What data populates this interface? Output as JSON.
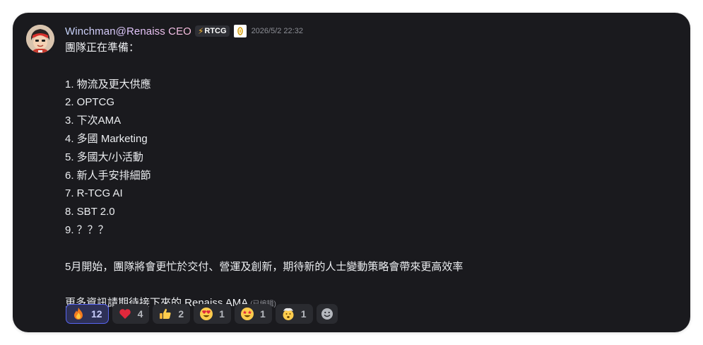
{
  "message": {
    "author": "Winchman@Renaiss CEO",
    "tag_label": "RTCG",
    "timestamp": "2026/5/2 22:32",
    "lines": [
      "團隊正在準備：",
      "",
      "1. 物流及更大供應",
      "2. OPTCG",
      "3. 下次AMA",
      "4. 多國 Marketing",
      "5. 多國大/小活動",
      "6. 新人手安排細節",
      "7. R-TCG AI",
      "8. SBT 2.0",
      "9. ？？？",
      "",
      "5月開始，團隊將會更忙於交付、營運及創新，期待新的人士變動策略會帶來更高效率",
      "",
      "更多資訊請期待接下來的 Renaiss AMA"
    ],
    "edited_label": "(已编辑)"
  },
  "reactions": [
    {
      "icon": "fire-emoji",
      "count": "12",
      "active": true
    },
    {
      "icon": "red-heart-emoji",
      "count": "4",
      "active": false
    },
    {
      "icon": "thumbs-up-emoji",
      "count": "2",
      "active": false
    },
    {
      "icon": "heart-eyes-emoji",
      "count": "1",
      "active": false
    },
    {
      "icon": "star-struck-emoji",
      "count": "1",
      "active": false
    },
    {
      "icon": "mind-blown-emoji",
      "count": "1",
      "active": false
    }
  ],
  "colors": {
    "card_background": "#1a1a1e",
    "active_reaction_border": "#5865f2",
    "timestamp": "#8c8e95"
  }
}
